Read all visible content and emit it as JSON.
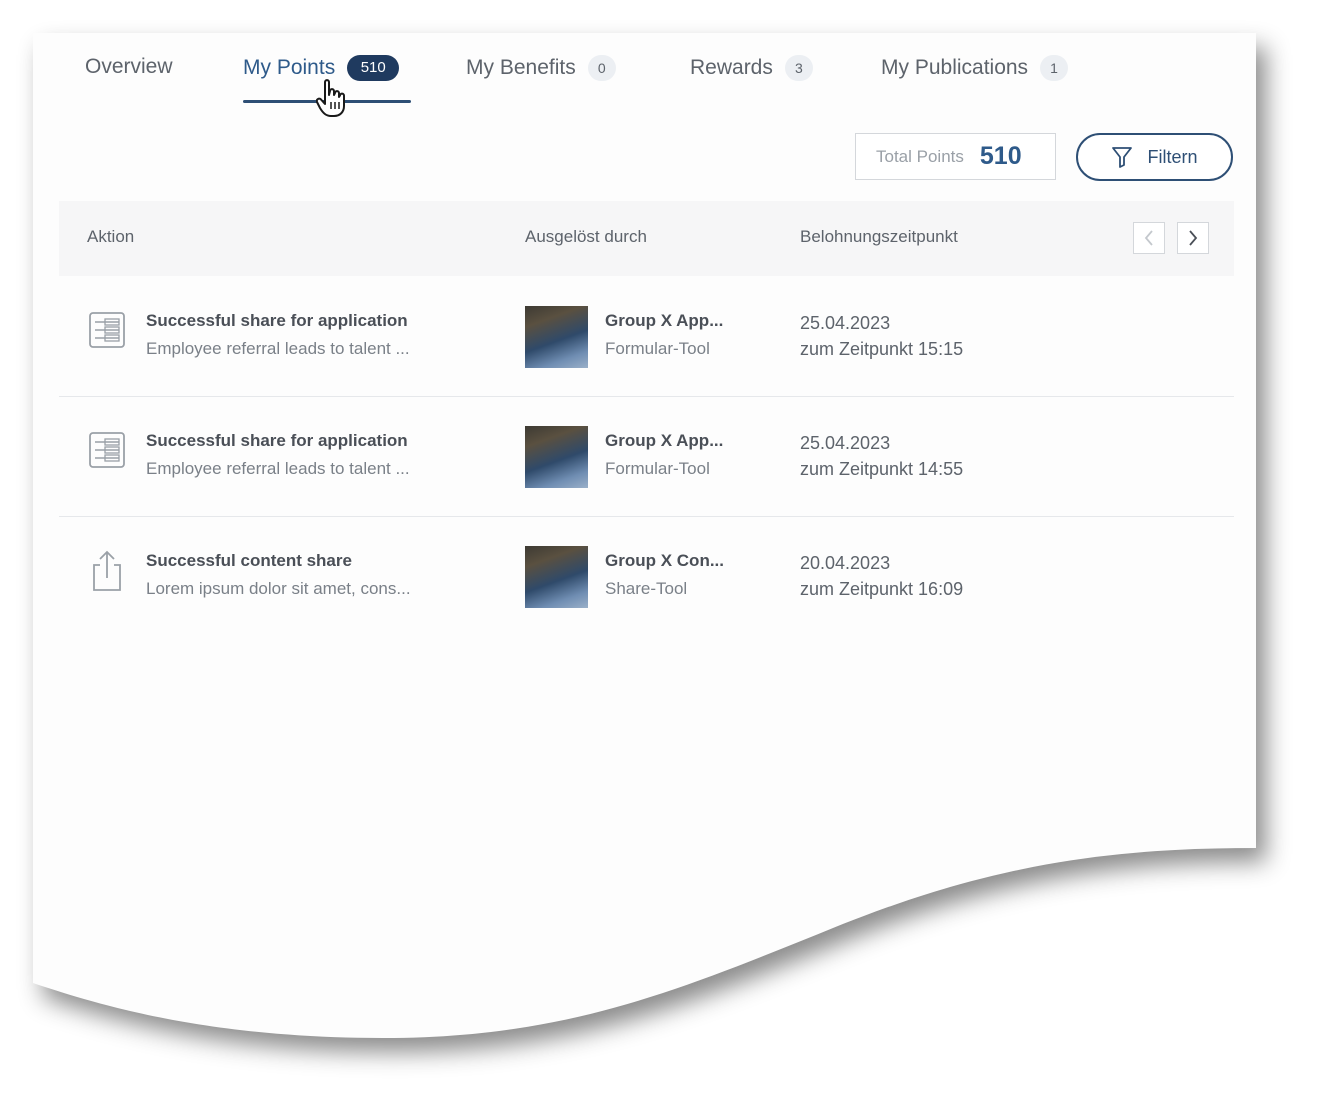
{
  "tabs": [
    {
      "label": "Overview",
      "badge": null
    },
    {
      "label": "My Points",
      "badge": "510",
      "active": true
    },
    {
      "label": "My Benefits",
      "badge": "0"
    },
    {
      "label": "Rewards",
      "badge": "3"
    },
    {
      "label": "My Publications",
      "badge": "1"
    }
  ],
  "summary": {
    "total_label": "Total Points",
    "total_value": "510",
    "filter_label": "Filtern"
  },
  "table": {
    "headers": {
      "action": "Aktion",
      "trigger": "Ausgelöst durch",
      "time": "Belohnungszeitpunkt"
    },
    "rows": [
      {
        "icon": "form-icon",
        "title": "Successful share for application",
        "subtitle": "Employee referral leads to talent ...",
        "source_title": "Group X App...",
        "source_subtitle": "Formular-Tool",
        "date": "25.04.2023",
        "time": "zum Zeitpunkt 15:15"
      },
      {
        "icon": "form-icon",
        "title": "Successful share for application",
        "subtitle": "Employee referral leads to talent ...",
        "source_title": "Group X App...",
        "source_subtitle": "Formular-Tool",
        "date": "25.04.2023",
        "time": "zum Zeitpunkt 14:55"
      },
      {
        "icon": "share-icon",
        "title": "Successful content share",
        "subtitle": "Lorem ipsum dolor sit amet, cons...",
        "source_title": "Group X Con...",
        "source_subtitle": "Share-Tool",
        "date": "20.04.2023",
        "time": "zum Zeitpunkt 16:09"
      }
    ]
  },
  "colors": {
    "accent": "#2e4f75",
    "badge_dark": "#1f3a5f",
    "header_bg": "#f6f6f7"
  }
}
